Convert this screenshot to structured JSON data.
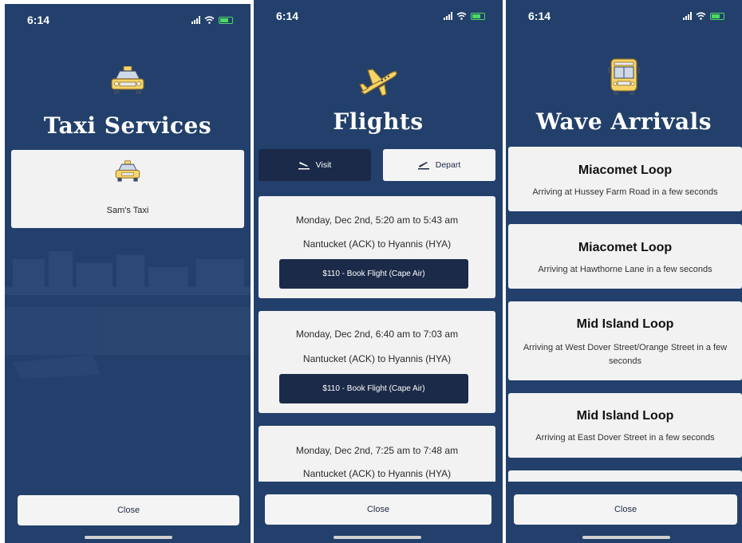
{
  "status_bar": {
    "time": "6:14"
  },
  "screens": {
    "taxi": {
      "title": "Taxi Services",
      "icon": "taxi-icon",
      "services": [
        {
          "name": "Sam's Taxi",
          "icon": "taxi-icon"
        }
      ],
      "close_label": "Close"
    },
    "flights": {
      "title": "Flights",
      "icon": "airplane-icon",
      "tabs": [
        {
          "label": "Visit",
          "icon": "plane-landing-icon",
          "selected": true
        },
        {
          "label": "Depart",
          "icon": "plane-takeoff-icon",
          "selected": false
        }
      ],
      "flights": [
        {
          "time": "Monday, Dec 2nd, 5:20 am to 5:43 am",
          "route": "Nantucket (ACK) to Hyannis (HYA)",
          "book_label": "$110 - Book Flight (Cape Air)"
        },
        {
          "time": "Monday, Dec 2nd, 6:40 am to 7:03 am",
          "route": "Nantucket (ACK) to Hyannis (HYA)",
          "book_label": "$110 - Book Flight (Cape Air)"
        },
        {
          "time": "Monday, Dec 2nd, 7:25 am to 7:48 am",
          "route": "Nantucket (ACK) to Hyannis (HYA)"
        }
      ],
      "close_label": "Close"
    },
    "wave": {
      "title": "Wave Arrivals",
      "icon": "bus-icon",
      "arrivals": [
        {
          "route": "Miacomet Loop",
          "detail": "Arriving at Hussey Farm Road in a few seconds"
        },
        {
          "route": "Miacomet Loop",
          "detail": "Arriving at Hawthorne Lane in a few seconds"
        },
        {
          "route": "Mid Island Loop",
          "detail": "Arriving at West Dover Street/Orange Street in a few seconds"
        },
        {
          "route": "Mid Island Loop",
          "detail": "Arriving at East Dover Street in a few seconds"
        }
      ],
      "close_label": "Close"
    }
  },
  "colors": {
    "background": "#22406b",
    "button_dark": "#1b2a48",
    "card": "#f2f2f2",
    "taxi_yellow": "#f7d567"
  }
}
